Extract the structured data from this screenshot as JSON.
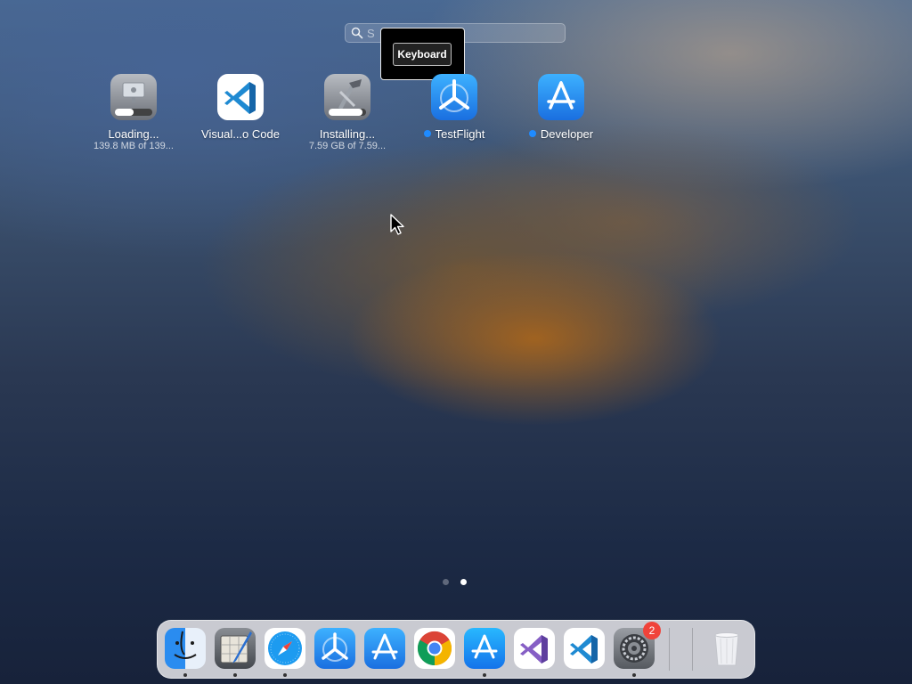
{
  "search": {
    "placeholder": "S"
  },
  "tooltip": {
    "key_label": "Keyboard"
  },
  "apps": [
    {
      "label": "Loading...",
      "sub": "139.8 MB of 139...",
      "progress": 0.5,
      "icon": "loading-app-icon"
    },
    {
      "label": "Visual...o Code",
      "sub": "",
      "icon": "vscode-icon"
    },
    {
      "label": "Installing...",
      "sub": "7.59 GB of 7.59...",
      "progress": 0.9,
      "icon": "xcode-icon"
    },
    {
      "label": "TestFlight",
      "sub": "",
      "new": true,
      "icon": "testflight-icon"
    },
    {
      "label": "Developer",
      "sub": "",
      "new": true,
      "icon": "developer-icon"
    }
  ],
  "pages": {
    "count": 2,
    "current": 2
  },
  "dock": {
    "items": [
      {
        "name": "finder-icon",
        "running": true
      },
      {
        "name": "script-editor-icon",
        "running": true
      },
      {
        "name": "safari-icon",
        "running": true
      },
      {
        "name": "testflight-icon",
        "running": false
      },
      {
        "name": "developer-icon",
        "running": false
      },
      {
        "name": "chrome-icon",
        "running": false
      },
      {
        "name": "app-store-icon",
        "running": true
      },
      {
        "name": "visual-studio-icon",
        "running": false
      },
      {
        "name": "vscode-icon",
        "running": false
      },
      {
        "name": "system-settings-icon",
        "running": true,
        "badge": "2"
      }
    ],
    "trash": "trash-icon"
  },
  "colors": {
    "accent": "#1f8bff",
    "badge": "#f0433a"
  }
}
